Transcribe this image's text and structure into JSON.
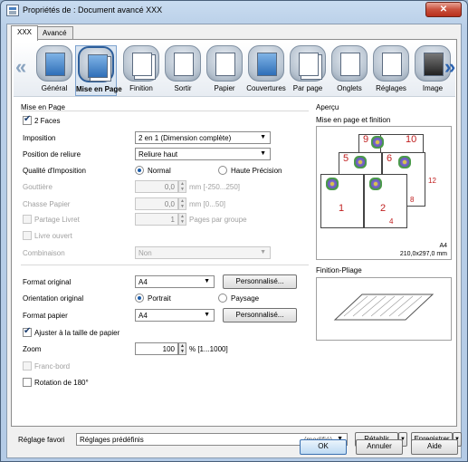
{
  "window": {
    "title": "Propriétés de : Document avancé XXX",
    "close": "✕"
  },
  "tabs": [
    {
      "label": "XXX"
    },
    {
      "label": "Avancé"
    }
  ],
  "toolbar": {
    "items": [
      {
        "label": "Général",
        "icon": "printer-icon"
      },
      {
        "label": "Mise en Page",
        "icon": "layout-icon"
      },
      {
        "label": "Finition",
        "icon": "finishing-icon"
      },
      {
        "label": "Sortir",
        "icon": "output-icon"
      },
      {
        "label": "Papier",
        "icon": "paper-icon"
      },
      {
        "label": "Couvertures",
        "icon": "cover-icon"
      },
      {
        "label": "Par page",
        "icon": "per-page-icon"
      },
      {
        "label": "Onglets",
        "icon": "tabs-icon"
      },
      {
        "label": "Réglages",
        "icon": "settings-icon"
      },
      {
        "label": "Image",
        "icon": "image-icon"
      }
    ]
  },
  "layout": {
    "section_title": "Mise en Page",
    "two_sided": "2 Faces",
    "imposition_label": "Imposition",
    "imposition_value": "2 en 1 (Dimension complète)",
    "binding_label": "Position de reliure",
    "binding_value": "Reliure haut",
    "quality_label": "Qualité d'Imposition",
    "quality_normal": "Normal",
    "quality_high": "Haute Précision",
    "gutter_label": "Gouttière",
    "gutter_value": "0,0",
    "gutter_unit": "mm [-250...250]",
    "creep_label": "Chasse Papier",
    "creep_value": "0,0",
    "creep_unit": "mm [0...50]",
    "split_booklet": "Partage Livret",
    "split_value": "1",
    "split_unit": "Pages par groupe",
    "open_book": "Livre ouvert",
    "combination_label": "Combinaison",
    "combination_value": "Non",
    "original_format_label": "Format original",
    "original_format_value": "A4",
    "custom_button": "Personnalisé...",
    "orientation_label": "Orientation original",
    "portrait": "Portrait",
    "landscape": "Paysage",
    "paper_format_label": "Format papier",
    "paper_format_value": "A4",
    "custom_button2": "Personnalisé...",
    "fit_to_paper": "Ajuster à la taille de papier",
    "zoom_label": "Zoom",
    "zoom_value": "100",
    "zoom_unit": "% [1...1000]",
    "edge_to_edge": "Franc-bord",
    "rotate_180": "Rotation de 180°"
  },
  "preview": {
    "title": "Aperçu",
    "layout_label": "Mise en page et finition",
    "paper_size": "A4",
    "paper_dims": "210,0x297,0 mm",
    "finish_label": "Finition-Pliage",
    "page_numbers": [
      "1",
      "2",
      "4",
      "5",
      "6",
      "8",
      "9",
      "10",
      "12"
    ]
  },
  "favorites": {
    "label": "Réglage favori",
    "value": "Réglages prédéfinis",
    "modified": "(modifié)",
    "restore": "Rétablir",
    "save": "Enregistrer"
  },
  "footer": {
    "ok": "OK",
    "cancel": "Annuler",
    "help": "Aide"
  }
}
